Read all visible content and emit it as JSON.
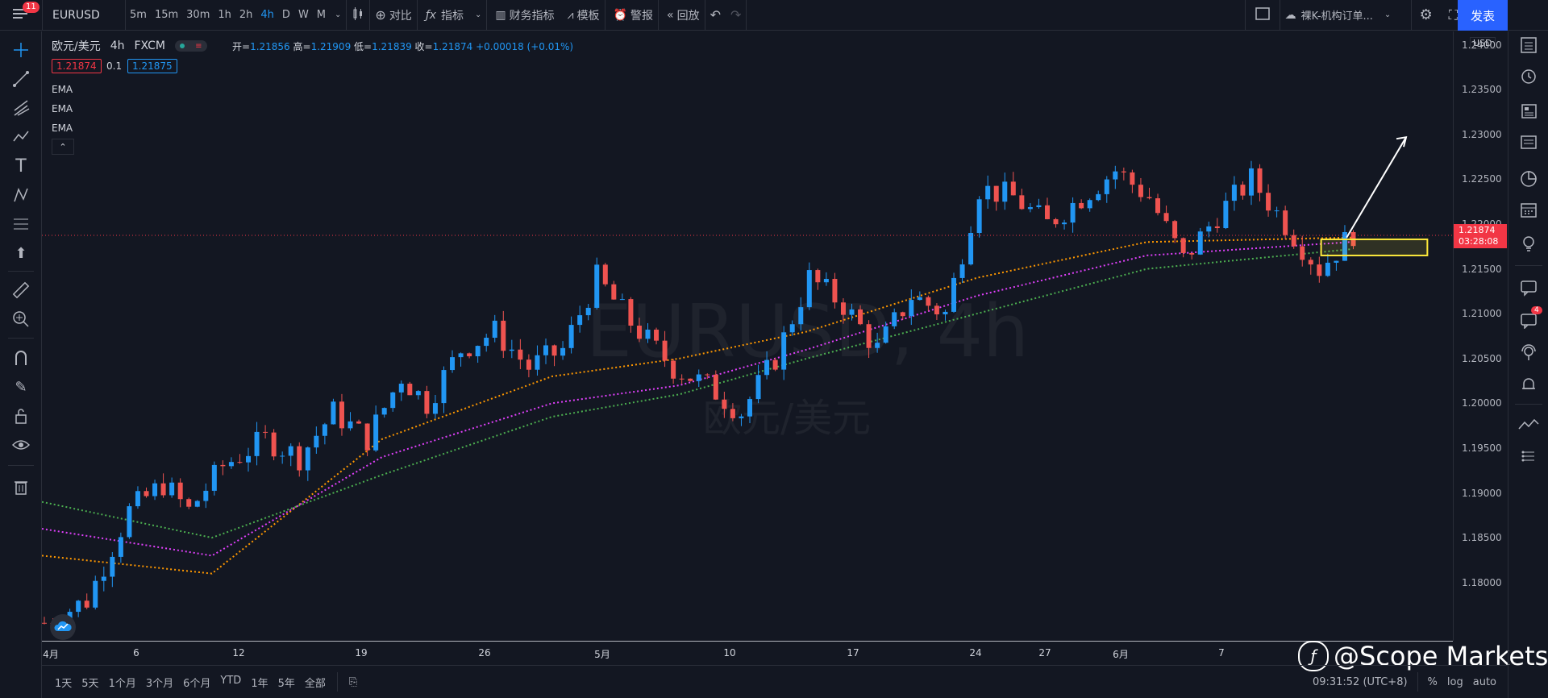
{
  "topbar": {
    "notifications": "11",
    "symbol": "EURUSD",
    "intervals": [
      "5m",
      "15m",
      "30m",
      "1h",
      "2h",
      "4h",
      "D",
      "W",
      "M"
    ],
    "active_interval": "4h",
    "compare": "对比",
    "indicators": "指标",
    "financials": "财务指标",
    "templates": "模板",
    "alert": "警报",
    "replay": "回放",
    "layout_name": "裸K-机构订单...",
    "publish": "发表"
  },
  "legend": {
    "title": "欧元/美元",
    "interval": "4h",
    "exchange": "FXCM",
    "open_label": "开=",
    "open": "1.21856",
    "high_label": "高=",
    "high": "1.21909",
    "low_label": "低=",
    "low": "1.21839",
    "close_label": "收=",
    "close": "1.21874",
    "change": "+0.00018 (+0.01%)",
    "sell_price": "1.21874",
    "qty": "0.1",
    "buy_price": "1.21875",
    "ema_labels": [
      "EMA",
      "EMA",
      "EMA"
    ],
    "collapse_glyph": "⌃"
  },
  "watermark": {
    "symbol": "EURUSD, 4h",
    "name": "欧元/美元"
  },
  "price_axis": {
    "currency": "USD",
    "current_price": "1.21874",
    "countdown": "03:28:08"
  },
  "time_axis": [
    "4月",
    "6",
    "12",
    "19",
    "26",
    "5月",
    "10",
    "17",
    "24",
    "27",
    "6月",
    "7"
  ],
  "bottombar": {
    "ranges": [
      "1天",
      "5天",
      "1个月",
      "3个月",
      "6个月",
      "YTD",
      "1年",
      "5年",
      "全部"
    ],
    "clock": "09:31:52 (UTC+8)",
    "percent": "%",
    "log": "log",
    "auto": "auto"
  },
  "brand": "@Scope Markets",
  "colors": {
    "bull": "#2196f3",
    "bear": "#ef5350",
    "ema_fast": "#ff9800",
    "ema_mid": "#e040fb",
    "ema_slow": "#4caf50",
    "highlight": "#ffeb3b"
  },
  "chart_data": {
    "type": "candlestick",
    "symbol": "EURUSD",
    "interval": "4h",
    "y_ticks": [
      1.24,
      1.235,
      1.23,
      1.225,
      1.22,
      1.215,
      1.21,
      1.205,
      1.2,
      1.195,
      1.19,
      1.185,
      1.18
    ],
    "ylim": [
      1.1735,
      1.2415
    ],
    "price_path": [
      [
        0,
        1.1755
      ],
      [
        5,
        1.178
      ],
      [
        10,
        1.188
      ],
      [
        14,
        1.191
      ],
      [
        17,
        1.188
      ],
      [
        21,
        1.193
      ],
      [
        26,
        1.196
      ],
      [
        30,
        1.194
      ],
      [
        34,
        1.199
      ],
      [
        38,
        1.196
      ],
      [
        42,
        1.203
      ],
      [
        45,
        1.2
      ],
      [
        49,
        1.206
      ],
      [
        53,
        1.208
      ],
      [
        57,
        1.204
      ],
      [
        61,
        1.206
      ],
      [
        65,
        1.214
      ],
      [
        69,
        1.209
      ],
      [
        74,
        1.204
      ],
      [
        78,
        1.202
      ],
      [
        82,
        1.199
      ],
      [
        86,
        1.205
      ],
      [
        90,
        1.214
      ],
      [
        94,
        1.211
      ],
      [
        98,
        1.206
      ],
      [
        102,
        1.212
      ],
      [
        106,
        1.21
      ],
      [
        110,
        1.224
      ],
      [
        114,
        1.223
      ],
      [
        118,
        1.22
      ],
      [
        122,
        1.223
      ],
      [
        126,
        1.226
      ],
      [
        130,
        1.223
      ],
      [
        134,
        1.216
      ],
      [
        138,
        1.221
      ],
      [
        142,
        1.225
      ],
      [
        146,
        1.22
      ],
      [
        150,
        1.215
      ],
      [
        154,
        1.219
      ]
    ],
    "ema_fast": [
      [
        0,
        1.183
      ],
      [
        20,
        1.181
      ],
      [
        40,
        1.196
      ],
      [
        60,
        1.203
      ],
      [
        75,
        1.205
      ],
      [
        90,
        1.208
      ],
      [
        110,
        1.214
      ],
      [
        130,
        1.218
      ],
      [
        154,
        1.2185
      ]
    ],
    "ema_mid": [
      [
        0,
        1.186
      ],
      [
        20,
        1.183
      ],
      [
        40,
        1.194
      ],
      [
        60,
        1.2
      ],
      [
        75,
        1.202
      ],
      [
        90,
        1.206
      ],
      [
        110,
        1.212
      ],
      [
        130,
        1.2165
      ],
      [
        154,
        1.218
      ]
    ],
    "ema_slow": [
      [
        0,
        1.189
      ],
      [
        20,
        1.185
      ],
      [
        40,
        1.192
      ],
      [
        60,
        1.1985
      ],
      [
        75,
        1.201
      ],
      [
        90,
        1.205
      ],
      [
        110,
        1.21
      ],
      [
        130,
        1.215
      ],
      [
        154,
        1.2172
      ]
    ],
    "zone": [
      1.2183,
      1.2165
    ]
  }
}
